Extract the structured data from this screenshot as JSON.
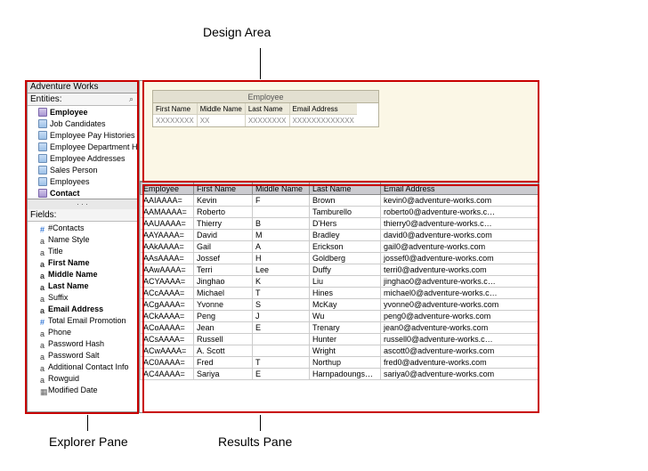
{
  "labels": {
    "design_area": "Design Area",
    "explorer_pane": "Explorer Pane",
    "results_pane": "Results Pane"
  },
  "explorer": {
    "title": "Adventure Works",
    "entities_label": "Entities:",
    "fields_label": "Fields:",
    "entities": [
      {
        "label": "Employee",
        "bold": true,
        "kind": "entity"
      },
      {
        "label": "Job Candidates",
        "kind": "folder"
      },
      {
        "label": "Employee Pay Histories",
        "kind": "folder"
      },
      {
        "label": "Employee Department Historie",
        "kind": "folder"
      },
      {
        "label": "Employee Addresses",
        "kind": "folder"
      },
      {
        "label": "Sales Person",
        "kind": "folder"
      },
      {
        "label": "Employees",
        "kind": "folder"
      },
      {
        "label": "Contact",
        "bold": true,
        "kind": "entity"
      }
    ],
    "fields": [
      {
        "label": "#Contacts",
        "kind": "num"
      },
      {
        "label": "Name Style",
        "kind": "txt"
      },
      {
        "label": "Title",
        "kind": "txt"
      },
      {
        "label": "First Name",
        "kind": "txt",
        "bold": true
      },
      {
        "label": "Middle Name",
        "kind": "txt",
        "bold": true
      },
      {
        "label": "Last Name",
        "kind": "txt",
        "bold": true
      },
      {
        "label": "Suffix",
        "kind": "txt"
      },
      {
        "label": "Email Address",
        "kind": "txt",
        "bold": true
      },
      {
        "label": "Total Email Promotion",
        "kind": "num"
      },
      {
        "label": "Phone",
        "kind": "txt"
      },
      {
        "label": "Password Hash",
        "kind": "txt"
      },
      {
        "label": "Password Salt",
        "kind": "txt"
      },
      {
        "label": "Additional Contact Info",
        "kind": "txt"
      },
      {
        "label": "Rowguid",
        "kind": "txt"
      },
      {
        "label": "Modified Date",
        "kind": "date"
      }
    ]
  },
  "design": {
    "entity_title": "Employee",
    "columns": [
      {
        "header": "First Name",
        "sample": "XXXXXXXX"
      },
      {
        "header": "Middle Name",
        "sample": "XX"
      },
      {
        "header": "Last Name",
        "sample": "XXXXXXXX"
      },
      {
        "header": "Email Address",
        "sample": "XXXXXXXXXXXXX"
      }
    ]
  },
  "results": {
    "headers": [
      "Employee",
      "First Name",
      "Middle Name",
      "Last Name",
      "Email Address"
    ],
    "rows": [
      [
        "AAIAAAA=",
        "Kevin",
        "F",
        "Brown",
        "kevin0@adventure-works.com"
      ],
      [
        "AAMAAAA=",
        "Roberto",
        "",
        "Tamburello",
        "roberto0@adventure-works.c…"
      ],
      [
        "AAUAAAA=",
        "Thierry",
        "B",
        "D'Hers",
        "thierry0@adventure-works.c…"
      ],
      [
        "AAYAAAA=",
        "David",
        "M",
        "Bradley",
        "david0@adventure-works.com"
      ],
      [
        "AAkAAAA=",
        "Gail",
        "A",
        "Erickson",
        "gail0@adventure-works.com"
      ],
      [
        "AAsAAAA=",
        "Jossef",
        "H",
        "Goldberg",
        "jossef0@adventure-works.com"
      ],
      [
        "AAwAAAA=",
        "Terri",
        "Lee",
        "Duffy",
        "terri0@adventure-works.com"
      ],
      [
        "ACYAAAA=",
        "Jinghao",
        "K",
        "Liu",
        "jinghao0@adventure-works.c…"
      ],
      [
        "ACcAAAA=",
        "Michael",
        "T",
        "Hines",
        "michael0@adventure-works.c…"
      ],
      [
        "ACgAAAA=",
        "Yvonne",
        "S",
        "McKay",
        "yvonne0@adventure-works.com"
      ],
      [
        "ACkAAAA=",
        "Peng",
        "J",
        "Wu",
        "peng0@adventure-works.com"
      ],
      [
        "ACoAAAA=",
        "Jean",
        "E",
        "Trenary",
        "jean0@adventure-works.com"
      ],
      [
        "ACsAAAA=",
        "Russell",
        "",
        "Hunter",
        "russell0@adventure-works.c…"
      ],
      [
        "ACwAAAA=",
        "A. Scott",
        "",
        "Wright",
        "ascott0@adventure-works.com"
      ],
      [
        "AC0AAAA=",
        "Fred",
        "T",
        "Northup",
        "fred0@adventure-works.com"
      ],
      [
        "AC4AAAA=",
        "Sariya",
        "E",
        "Harnpadoungsa…",
        "sariya0@adventure-works.com"
      ]
    ]
  }
}
